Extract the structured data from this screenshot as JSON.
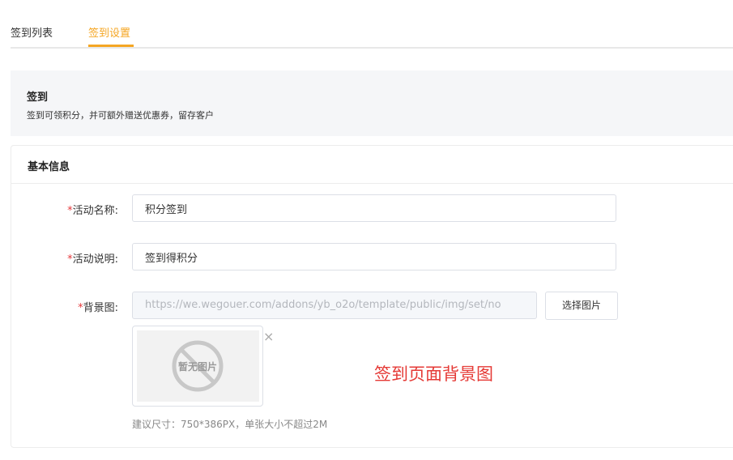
{
  "tabs": [
    {
      "label": "签到列表"
    },
    {
      "label": "签到设置"
    }
  ],
  "info": {
    "title": "签到",
    "description": "签到可领积分，并可额外赠送优惠券，留存客户"
  },
  "card": {
    "title": "基本信息"
  },
  "form": {
    "required_mark": "*",
    "activity_name_label": "活动名称:",
    "activity_name_value": "积分签到",
    "activity_desc_label": "活动说明:",
    "activity_desc_value": "签到得积分",
    "background_label": "背景图:",
    "background_url": "https://we.wegouer.com/addons/yb_o2o/template/public/img/set/no",
    "choose_image_button": "选择图片",
    "no_image_text": "暂无图片",
    "close_icon": "×",
    "background_hint": "签到页面背景图",
    "size_hint": "建议尺寸：750*386PX，单张大小不超过2M"
  },
  "colors": {
    "accent": "#f5a623",
    "required": "#e5383b",
    "overlay_text": "#e53935"
  },
  "icons": {
    "no_image": "no-image-icon",
    "close": "close-icon"
  }
}
